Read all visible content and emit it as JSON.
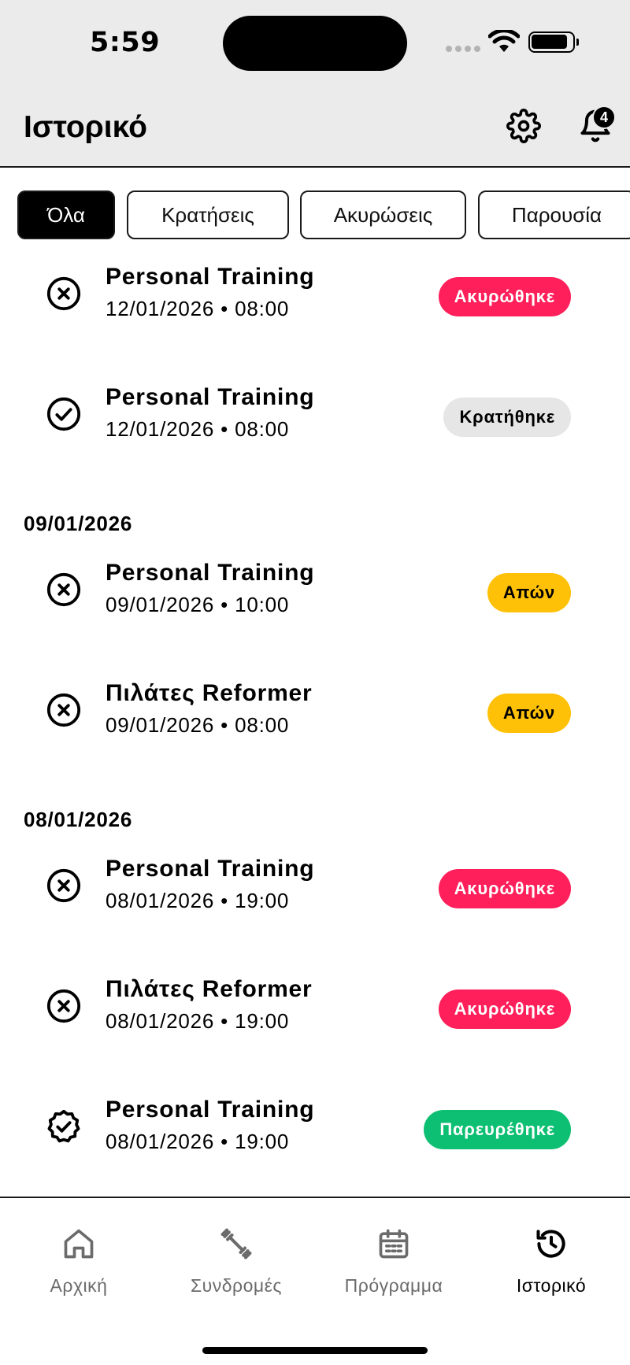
{
  "status_bar": {
    "time": "5:59"
  },
  "header": {
    "title": "Ιστορικό",
    "notification_count": "4"
  },
  "filters": [
    {
      "label": "Όλα",
      "active": true
    },
    {
      "label": "Κρατήσεις",
      "active": false
    },
    {
      "label": "Ακυρώσεις",
      "active": false
    },
    {
      "label": "Παρουσία",
      "active": false
    }
  ],
  "sections": [
    {
      "date": ""
    },
    {
      "date": "09/01/2026"
    },
    {
      "date": "08/01/2026"
    }
  ],
  "items": [
    {
      "name": "Personal Training",
      "when": "12/01/2026 • 08:00",
      "status": "Ακυρώθηκε",
      "icon": "x-circle-icon"
    },
    {
      "name": "Personal Training",
      "when": "12/01/2026 • 08:00",
      "status": "Κρατήθηκε",
      "icon": "check-circle-icon"
    },
    {
      "name": "Personal Training",
      "when": "09/01/2026 • 10:00",
      "status": "Απών",
      "icon": "x-circle-icon"
    },
    {
      "name": "Πιλάτες Reformer",
      "when": "09/01/2026 • 08:00",
      "status": "Απών",
      "icon": "x-circle-icon"
    },
    {
      "name": "Personal Training",
      "when": "08/01/2026 • 19:00",
      "status": "Ακυρώθηκε",
      "icon": "x-circle-icon"
    },
    {
      "name": "Πιλάτες Reformer",
      "when": "08/01/2026 • 19:00",
      "status": "Ακυρώθηκε",
      "icon": "x-circle-icon"
    },
    {
      "name": "Personal Training",
      "when": "08/01/2026 • 19:00",
      "status": "Παρευρέθηκε",
      "icon": "verified-badge-icon"
    }
  ],
  "status_colors": {
    "cancelled": {
      "bg": "#ff1f5a",
      "fg": "#ffffff"
    },
    "booked": {
      "bg": "#e6e6e6",
      "fg": "#000000"
    },
    "absent": {
      "bg": "#ffc107",
      "fg": "#000000"
    },
    "attended": {
      "bg": "#0dbf72",
      "fg": "#ffffff"
    }
  },
  "bottom_nav": [
    {
      "label": "Αρχική",
      "icon": "home-icon",
      "active": false
    },
    {
      "label": "Συνδρομές",
      "icon": "dumbbell-icon",
      "active": false
    },
    {
      "label": "Πρόγραμμα",
      "icon": "calendar-icon",
      "active": false
    },
    {
      "label": "Ιστορικό",
      "icon": "history-icon",
      "active": true
    }
  ]
}
